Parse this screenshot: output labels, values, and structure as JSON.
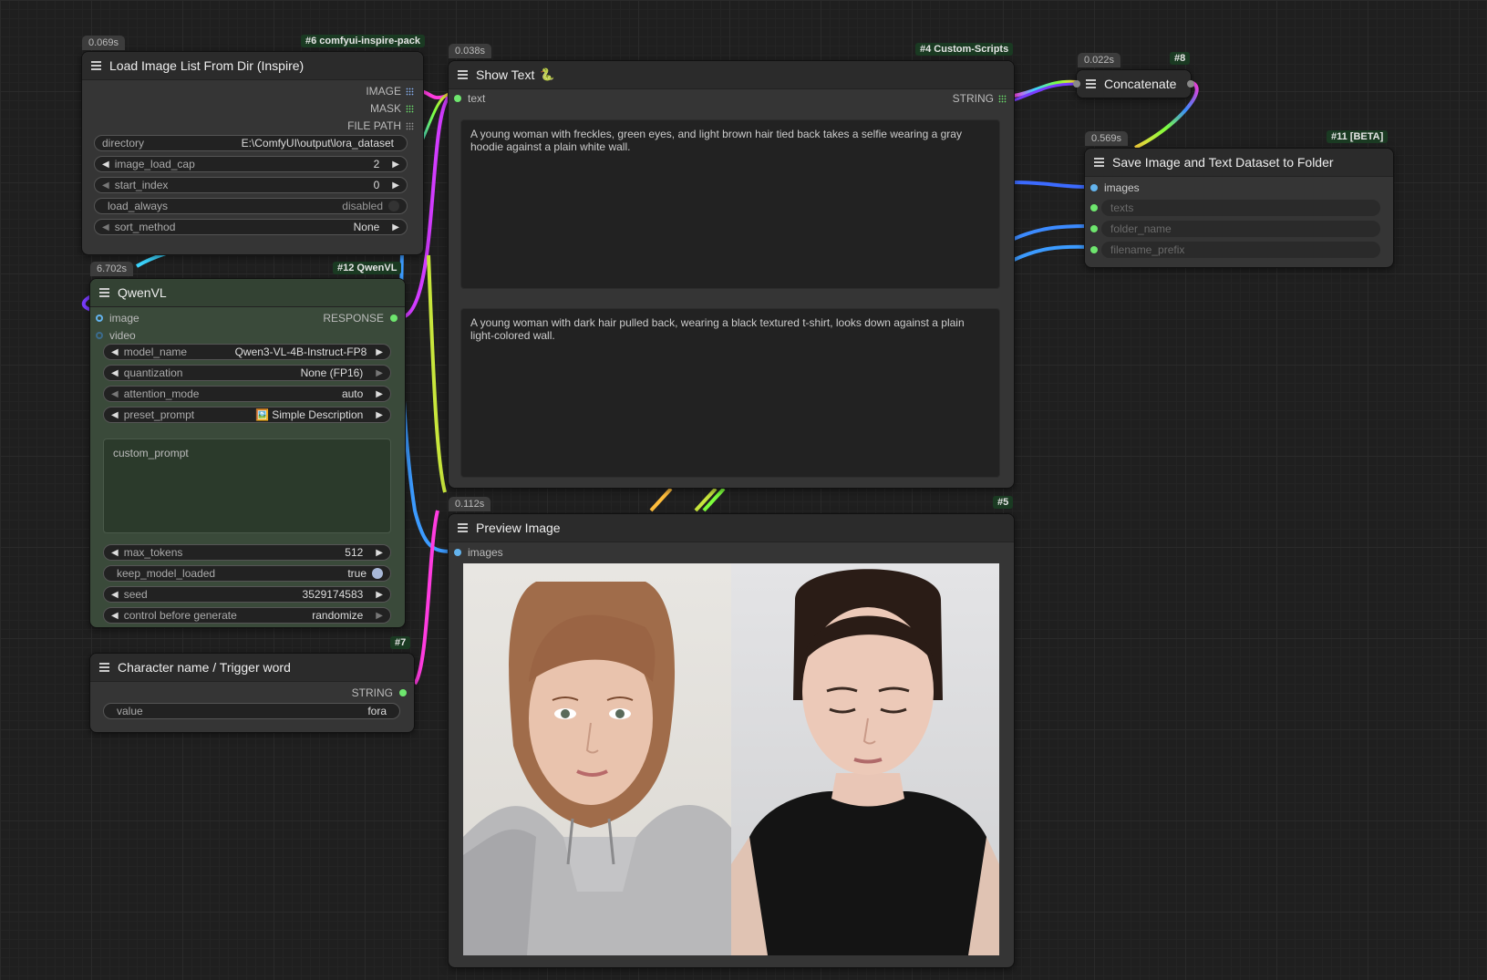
{
  "colors": {
    "canvas": "#1f1f1f",
    "node_bg": "#353535",
    "node_green": "#3a4a3a",
    "badge_bg": "#1a3a22",
    "image_slot": "#63b3ed",
    "string_slot": "#6ee66e"
  },
  "load_image": {
    "timing": "0.069s",
    "badge": "#6 comfyui-inspire-pack",
    "title": "Load Image List From Dir (Inspire)",
    "outputs": [
      "IMAGE",
      "MASK",
      "FILE PATH"
    ],
    "widgets": {
      "directory": {
        "name": "directory",
        "value": "E:\\ComfyUI\\output\\lora_dataset"
      },
      "image_load_cap": {
        "name": "image_load_cap",
        "value": "2"
      },
      "start_index": {
        "name": "start_index",
        "value": "0"
      },
      "load_always": {
        "name": "load_always",
        "value": "disabled"
      },
      "sort_method": {
        "name": "sort_method",
        "value": "None"
      }
    }
  },
  "qwen": {
    "timing": "6.702s",
    "badge": "#12 QwenVL",
    "title": "QwenVL",
    "inputs": [
      "image",
      "video"
    ],
    "output": "RESPONSE",
    "widgets": {
      "model_name": {
        "name": "model_name",
        "value": "Qwen3-VL-4B-Instruct-FP8"
      },
      "quantization": {
        "name": "quantization",
        "value": "None (FP16)"
      },
      "attention_mode": {
        "name": "attention_mode",
        "value": "auto"
      },
      "preset_prompt": {
        "name": "preset_prompt",
        "value": "🖼️ Simple Description"
      },
      "custom_prompt": "custom_prompt",
      "max_tokens": {
        "name": "max_tokens",
        "value": "512"
      },
      "keep_model_loaded": {
        "name": "keep_model_loaded",
        "value": "true"
      },
      "seed": {
        "name": "seed",
        "value": "3529174583"
      },
      "control": {
        "name": "control before generate",
        "value": "randomize"
      }
    }
  },
  "character": {
    "badge": "#7",
    "title": "Character name / Trigger word",
    "output": "STRING",
    "widget": {
      "name": "value",
      "value": "fora"
    }
  },
  "show_text": {
    "timing": "0.038s",
    "badge": "#4 Custom-Scripts",
    "title": "Show Text",
    "title_icon": "python-snake-icon",
    "input": "text",
    "output": "STRING",
    "texts": [
      "A young woman with freckles, green eyes, and light brown hair tied back takes a selfie wearing a gray hoodie against a plain white wall.",
      "A young woman with dark hair pulled back, wearing a black textured t-shirt, looks down against a plain light-colored wall."
    ]
  },
  "preview": {
    "timing": "0.112s",
    "badge": "#5",
    "title": "Preview Image",
    "input": "images"
  },
  "concatenate": {
    "timing": "0.022s",
    "badge": "#8",
    "title": "Concatenate"
  },
  "save_dataset": {
    "timing": "0.569s",
    "badge": "#11 [BETA]",
    "title": "Save Image and Text Dataset to Folder",
    "inputs": [
      "images",
      "texts",
      "folder_name",
      "filename_prefix"
    ]
  }
}
